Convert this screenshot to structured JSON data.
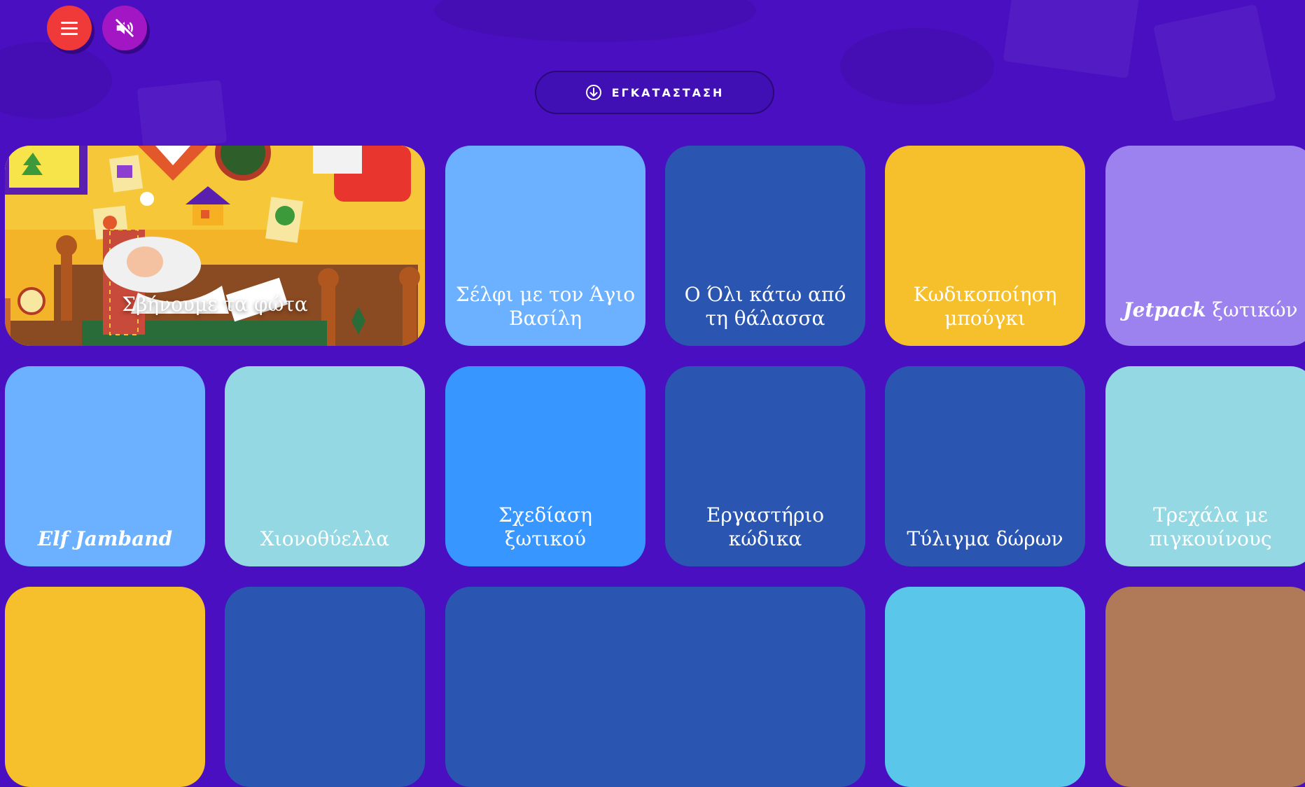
{
  "colors": {
    "background": "#4a0fc0",
    "menu_button": "#f03a3a",
    "sound_button": "#a316c4"
  },
  "header": {
    "menu_icon": "hamburger-menu-icon",
    "sound_icon": "speaker-muted-icon",
    "install_icon": "download-circle-icon",
    "install_label": "ΕΓΚΑΤΑΣΤΑΣΗ"
  },
  "tiles": [
    {
      "label": "Σβήνουμε τα φώτα",
      "color": "#f3b429",
      "type": "video",
      "icon": "youtube-play-icon"
    },
    {
      "label": "Σέλφι με τον Άγιο Βασίλη",
      "color": "#6bb1ff"
    },
    {
      "label": "Ο Όλι κάτω από τη θάλασσα",
      "color": "#2a56b1"
    },
    {
      "label": "Κωδικοποίηση μπούγκι",
      "color": "#f6bf2c"
    },
    {
      "label_a": "Jetpack",
      "label_b": " ξωτικών",
      "color": "#9c82ef"
    },
    {
      "label": "Elf Jamband",
      "color": "#6bb1ff"
    },
    {
      "label": "Χιονοθύελλα",
      "color": "#93d8e2"
    },
    {
      "label": "Σχεδίαση ξωτικού",
      "color": "#3796ff"
    },
    {
      "label": "Εργαστήριο κώδικα",
      "color": "#2a56b1"
    },
    {
      "label": "Τύλιγμα δώρων",
      "color": "#2a56b1"
    },
    {
      "label": "Τρεχάλα με πιγκουίνους",
      "color": "#93d8e2"
    }
  ],
  "row3_colors": [
    "#f6bf2c",
    "#2a56b1",
    "#2a56b1",
    "#5ac6ea",
    "#b07a58"
  ]
}
